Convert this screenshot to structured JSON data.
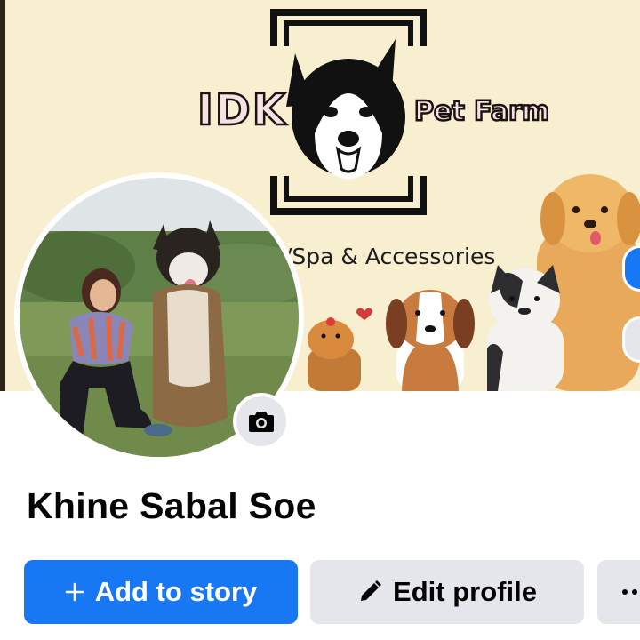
{
  "cover": {
    "logo_idk": "IDK",
    "logo_pet_farm": "Pet Farm",
    "subtitle": "/Spa & Accessories"
  },
  "profile": {
    "name": "Khine Sabal Soe"
  },
  "actions": {
    "add_to_story": "Add to story",
    "edit_profile": "Edit profile"
  },
  "icons": {
    "add": "plus-icon",
    "edit": "pencil-icon",
    "camera": "camera-icon",
    "more": "more-dots-icon"
  },
  "colors": {
    "primary": "#1877f2",
    "secondary_button": "#e4e6eb",
    "cover_background": "#f7efcf",
    "text": "#050505"
  }
}
